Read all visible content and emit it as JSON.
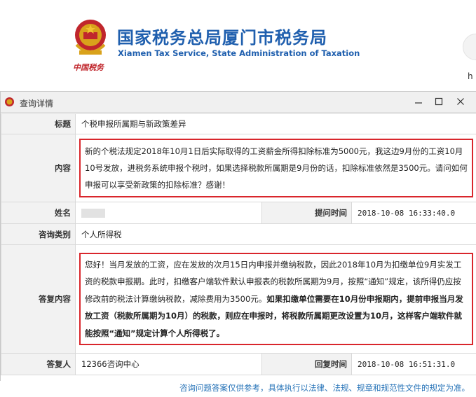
{
  "site": {
    "title_cn": "国家税务总局厦门市税务局",
    "title_en": "Xiamen Tax Service, State Administration of Taxation",
    "emblem_caption": "中国税务",
    "side_label": "h"
  },
  "dialog": {
    "title": "查询详情"
  },
  "form": {
    "labels": {
      "title": "标题",
      "content": "内容",
      "name": "姓名",
      "ask_time": "提问时间",
      "category": "咨询类别",
      "answer": "答复内容",
      "answerer": "答复人",
      "reply_time": "回复时间"
    },
    "title_value": "个税申报所属期与新政策差异",
    "content_value": "新的个税法规定2018年10月1日后实际取得的工资薪金所得扣除标准为5000元，我这边9月份的工资10月10号发放，进税务系统申报个税时，如果选择税款所属期是9月份的话，扣除标准依然是3500元。请问如何申报可以享受新政策的扣除标准？感谢！",
    "ask_time_value": "2018-10-08 16:33:40.0",
    "category_value": "个人所得税",
    "answer_normal": "您好！当月发放的工资，应在发放的次月15日内申报并缴纳税款，因此2018年10月为扣缴单位9月实发工资的税款申报期。此时，扣缴客户端软件默认申报表的税款所属期为9月，按照“通知”规定，该所得仍应按修改前的税法计算缴纳税款，减除费用为3500元。",
    "answer_bold": "如果扣缴单位需要在10月份申报期内，提前申报当月发放工资（税款所属期为10月）的税款，则应在申报时，将税款所属期更改设置为10月，这样客户端软件就能按照“通知”规定计算个人所得税了。",
    "answerer_value": "12366咨询中心",
    "reply_time_value": "2018-10-08 16:51:31.0"
  },
  "footer": {
    "note": "咨询问题答案仅供参考，具体执行以法律、法规、规章和规范性文件的规定为准。"
  },
  "colors": {
    "brand_blue": "#1f5fae",
    "highlight_red": "#d9262c",
    "footer_blue": "#2874b8"
  },
  "icons": {
    "emblem": "national-emblem-icon",
    "titlebar": "app-emblem-icon",
    "minimize": "minimize-icon",
    "maximize": "maximize-icon",
    "close": "close-icon"
  }
}
